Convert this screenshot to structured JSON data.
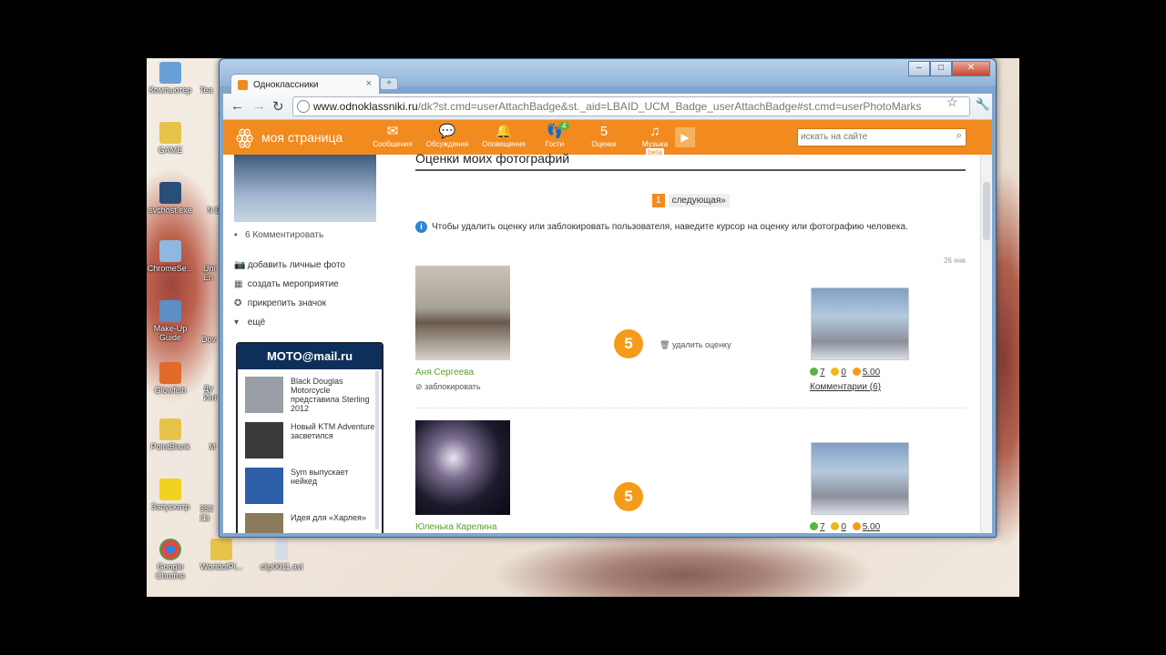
{
  "desktop": {
    "icons": [
      {
        "label": "Компьютер"
      },
      {
        "label": "GAME"
      },
      {
        "label": "svchost.exe"
      },
      {
        "label": "ChromeSe..."
      },
      {
        "label": "Make-Up Guide"
      },
      {
        "label": "Glowfish"
      },
      {
        "label": "PointBlank"
      },
      {
        "label": "Запускатр"
      },
      {
        "label": "Google Chrome"
      },
      {
        "label": "WorldofPl..."
      },
      {
        "label": "clip0011.avi"
      }
    ],
    "partial_icons": [
      {
        "label": "Tea"
      },
      {
        "label": "N De"
      },
      {
        "label": "Uni En"
      },
      {
        "label": "Dov"
      },
      {
        "label": "Ду Инт"
      },
      {
        "label": "M"
      },
      {
        "label": "352 (1)"
      }
    ]
  },
  "browser": {
    "tab_title": "Одноклассники",
    "tab_close": "×",
    "new_tab": "+",
    "window_buttons": {
      "minimize": "–",
      "maximize": "□",
      "close": "✕"
    },
    "nav": {
      "back": "←",
      "forward": "→",
      "reload": "↻"
    },
    "url_domain": "www.odnoklassniki.ru",
    "url_path": "/dk?st.cmd=userAttachBadge&st._aid=LBAID_UCM_Badge_userAttachBadge#st.cmd=userPhotoMarks",
    "star": "☆",
    "wrench": "🔧"
  },
  "ok": {
    "logo": "ꙮ",
    "my_page": "моя страница",
    "nav": [
      {
        "label": "Сообщения",
        "glyph": "✉"
      },
      {
        "label": "Обсуждения",
        "glyph": "💬"
      },
      {
        "label": "Оповещения",
        "glyph": "🔔"
      },
      {
        "label": "Гости",
        "glyph": "👣",
        "badge": "4"
      },
      {
        "label": "Оценки",
        "glyph": "5"
      },
      {
        "label": "Музыка",
        "glyph": "♫",
        "beta": "beta"
      }
    ],
    "play": "▶",
    "search_placeholder": "искать на сайте",
    "search_icon": "⌕"
  },
  "left": {
    "comments": "6 Комментировать",
    "links": [
      {
        "label": "добавить личные фото",
        "icon": "📷"
      },
      {
        "label": "создать мероприятие",
        "icon": "▦"
      },
      {
        "label": "прикрепить значок",
        "icon": "✪"
      },
      {
        "label": "ещё",
        "icon": "▾"
      }
    ],
    "ad": {
      "title": "MOTO@mail.ru",
      "items": [
        {
          "text": "Black Douglas Motorcycle представила Sterling 2012"
        },
        {
          "text": "Новый KTM Adventure засветился"
        },
        {
          "text": "Sym выпускает нейкед"
        },
        {
          "text": "Идея для «Харлея»"
        }
      ]
    }
  },
  "main": {
    "heading": "Оценки моих фотографий",
    "pager": {
      "page": "1",
      "next": "следующая»"
    },
    "info": "Чтобы удалить оценку или заблокировать пользователя, наведите курсор на оценку или фотографию человека.",
    "info_icon": "i",
    "date": "26 янв",
    "entries": [
      {
        "name": "Аня Сергеева",
        "block": "заблокировать",
        "mark": "5",
        "delete": "удалить оценку",
        "stats": {
          "a": "7",
          "b": "0",
          "c": "5.00"
        },
        "comments": "Комментарии (6)"
      },
      {
        "name": "Юленька Карелина",
        "block": "",
        "mark": "5",
        "delete": "",
        "stats": {
          "a": "7",
          "b": "0",
          "c": "5.00"
        },
        "comments": ""
      }
    ]
  }
}
